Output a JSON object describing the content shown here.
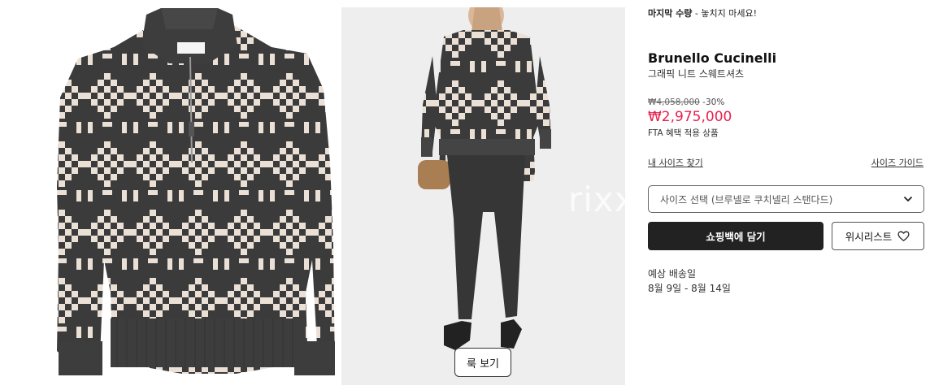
{
  "notice": {
    "bold": "마지막 수량",
    "rest": " - 놓치지 마세요!"
  },
  "product": {
    "brand": "Brunello Cucinelli",
    "name": "그래픽 니트 스웨트셔츠",
    "original_price": "₩4,058,000",
    "discount": "-30%",
    "price": "₩2,975,000",
    "benefit": "FTA 혜택 적용 상품"
  },
  "size": {
    "my_size": "내 사이즈 찾기",
    "guide": "사이즈 가이드",
    "placeholder": "사이즈 선택 (브루넬로 쿠치넬리 스탠다드)"
  },
  "actions": {
    "cart": "쇼핑백에 담기",
    "wishlist": "위시리스트"
  },
  "shipping": {
    "label": "예상 배송일",
    "dates": "8월 9일 - 8월 14일"
  },
  "gallery": {
    "look_button": "룩 보기",
    "watermark": "rixx"
  },
  "colors": {
    "price_red": "#e6224f",
    "dark": "#222222",
    "knit_dark": "#3b3b3b",
    "knit_light": "#eae0d6"
  }
}
